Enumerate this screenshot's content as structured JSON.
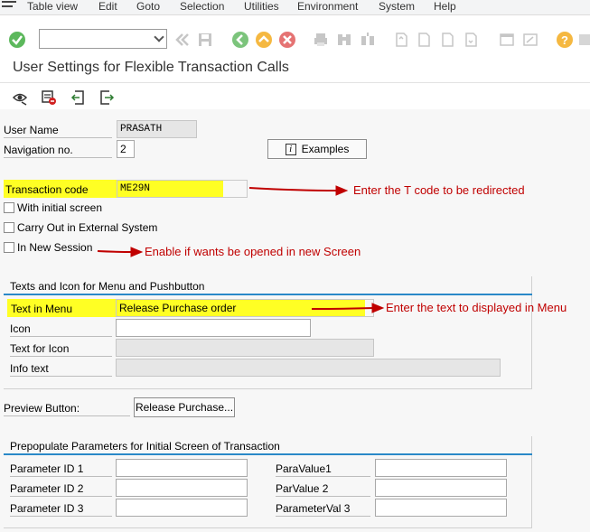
{
  "menu": {
    "items": [
      "Table view",
      "Edit",
      "Goto",
      "Selection",
      "Utilities",
      "Environment",
      "System",
      "Help"
    ]
  },
  "title": "User Settings for Flexible Transaction Calls",
  "form": {
    "user_name_label": "User Name",
    "user_name_value": "PRASATH",
    "nav_no_label": "Navigation no.",
    "nav_no_value": "2",
    "examples_label": "Examples",
    "tcode_label": "Transaction code",
    "tcode_value": "ME29N",
    "with_initial_screen": "With initial screen",
    "carry_out_external": "Carry Out in External System",
    "in_new_session": "In New Session"
  },
  "texts_group": {
    "title": "Texts and Icon for Menu and Pushbutton",
    "text_in_menu_label": "Text in Menu",
    "text_in_menu_value": "Release Purchase order",
    "icon_label": "Icon",
    "text_for_icon_label": "Text for Icon",
    "info_text_label": "Info text"
  },
  "preview": {
    "label": "Preview Button:",
    "button_label": "Release Purchase..."
  },
  "params_group": {
    "title": "Prepopulate Parameters for Initial Screen of Transaction",
    "param1_label": "Parameter ID 1",
    "param2_label": "Parameter ID 2",
    "param3_label": "Parameter ID 3",
    "val1_label": "ParaValue1",
    "val2_label": "ParValue 2",
    "val3_label": "ParameterVal 3"
  },
  "annotations": {
    "tcode_note": "Enter the T code to be redirected",
    "session_note": "Enable if wants be opened in new Screen",
    "menu_note": "Enter the text to displayed in Menu"
  },
  "colors": {
    "highlight": "#ffff24",
    "annotation": "#c00000",
    "group_line": "#2a89c8"
  }
}
